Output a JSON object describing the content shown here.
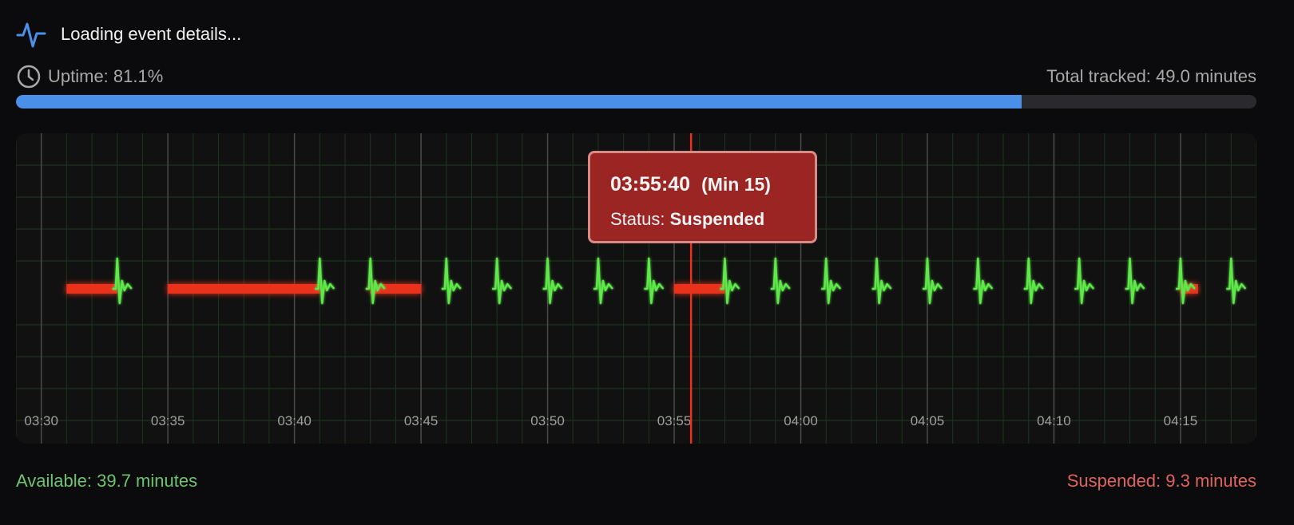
{
  "header": {
    "title": "Loading event details...",
    "icon": "activity-icon"
  },
  "uptime": {
    "label": "Uptime: 81.1%",
    "percent": 81.1,
    "total_label": "Total tracked: 49.0 minutes",
    "icon": "clock-icon"
  },
  "colors": {
    "accent": "#4a90e8",
    "available": "#6dc46d",
    "suspended": "#e0645e",
    "pulse": "#5ee84a",
    "baseline": "#e8321e"
  },
  "tooltip": {
    "time": "03:55:40",
    "minute": "(Min 15)",
    "status_label": "Status:",
    "status_value": "Suspended"
  },
  "legend": {
    "available": "Available: 39.7 minutes",
    "suspended": "Suspended: 9.3 minutes"
  },
  "chart_data": {
    "type": "line",
    "x_ticks": [
      "03:30",
      "03:35",
      "03:40",
      "03:45",
      "03:50",
      "03:55",
      "04:00",
      "04:05",
      "04:10",
      "04:15"
    ],
    "x_range": [
      "03:29",
      "04:18"
    ],
    "cursor_time": "03:55:40",
    "available_pulse_times": [
      "03:33",
      "03:41",
      "03:43",
      "03:46",
      "03:48",
      "03:50",
      "03:52",
      "03:54",
      "03:57",
      "03:59",
      "04:01",
      "04:03",
      "04:05",
      "04:07",
      "04:09",
      "04:11",
      "04:13",
      "04:15",
      "04:17"
    ],
    "suspended_segments": [
      [
        "03:31",
        "03:33"
      ],
      [
        "03:35",
        "03:41"
      ],
      [
        "03:43",
        "03:45"
      ],
      [
        "03:55",
        "03:57"
      ],
      [
        "04:15",
        "04:15"
      ]
    ],
    "grid": true
  }
}
